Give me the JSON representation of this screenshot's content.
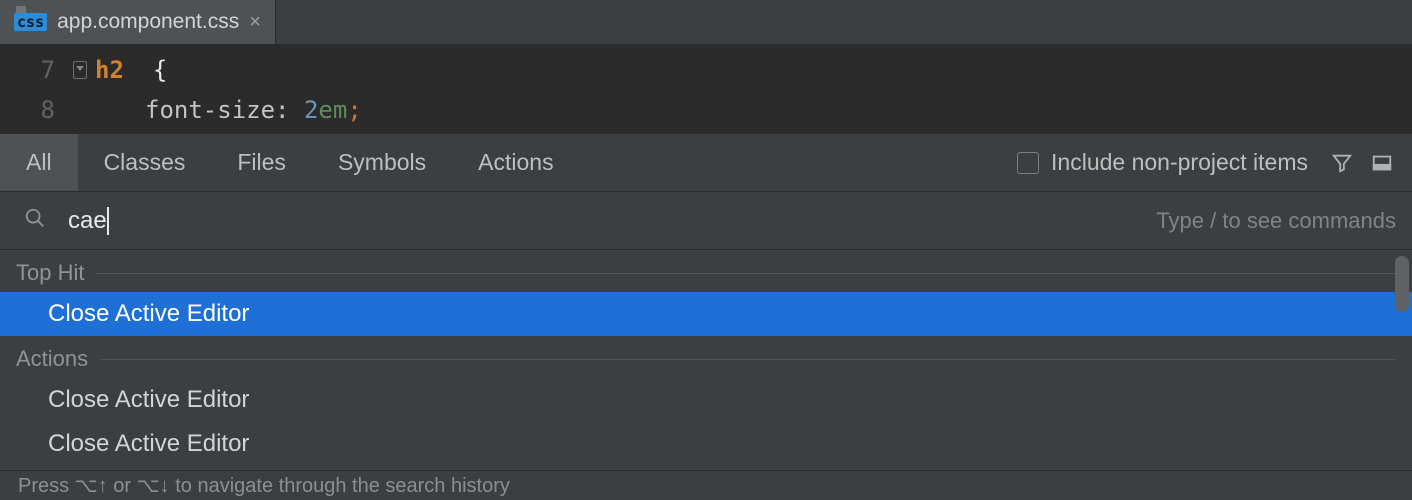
{
  "tab": {
    "badge": "css",
    "filename": "app.component.css"
  },
  "code": {
    "lines": [
      {
        "num": "7",
        "tokens": {
          "selector": "h2",
          "brace": "{"
        },
        "fold": true
      },
      {
        "num": "8",
        "tokens": {
          "prop": "font-size",
          "colon": ":",
          "num": "2",
          "unit": "em",
          "semi": ";"
        }
      }
    ]
  },
  "search": {
    "tabs": [
      "All",
      "Classes",
      "Files",
      "Symbols",
      "Actions"
    ],
    "active_tab_index": 0,
    "include_label": "Include non-project items",
    "query": "cae",
    "placeholder_hint": "Type / to see commands",
    "sections": [
      {
        "title": "Top Hit",
        "items": [
          "Close Active Editor"
        ],
        "selected_index": 0
      },
      {
        "title": "Actions",
        "items": [
          "Close Active Editor",
          "Close Active Editor"
        ]
      }
    ],
    "footer_hint": "Press ⌥↑ or ⌥↓ to navigate through the search history"
  }
}
